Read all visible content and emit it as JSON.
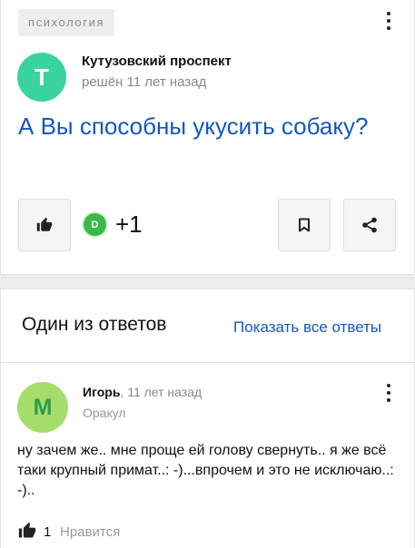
{
  "question": {
    "tag": "психология",
    "author": {
      "initial": "Т",
      "name": "Кутузовский проспект",
      "meta": "решён 11 лет назад"
    },
    "title": "А Вы способны укусить собаку?",
    "reactions": {
      "avatar_initial": "D",
      "count": "+1"
    }
  },
  "answers": {
    "heading": "Один из ответов",
    "show_all": "Показать все ответы",
    "answer": {
      "initial": "М",
      "name": "Игорь",
      "time": ", 11 лет назад",
      "rank": "Оракул",
      "text": "ну зачем же.. мне проще ей голову свернуть.. я же всё таки крупный примат..: -)...впрочем и это не исключаю..: -)..",
      "likes": "1",
      "like_label": "Нравится"
    }
  },
  "colors": {
    "link": "#1457c0",
    "author_avatar": "#3ad29f",
    "answer_avatar": "#a4dd69",
    "reaction_avatar": "#3ab84a"
  },
  "icons": [
    "kebab-menu-icon",
    "thumbs-up-icon",
    "bookmark-icon",
    "share-icon"
  ]
}
